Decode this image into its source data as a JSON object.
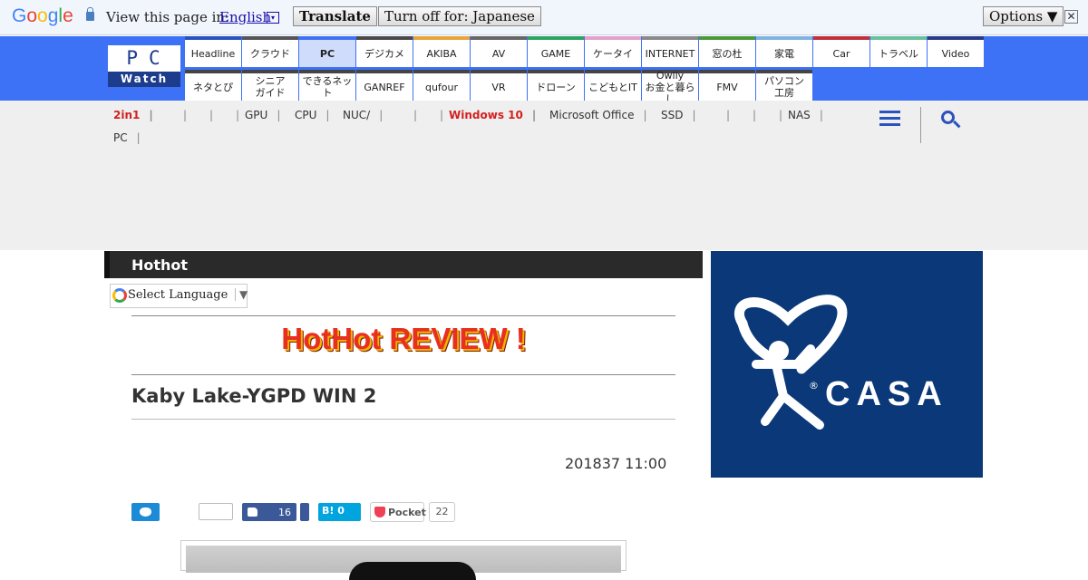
{
  "translate_bar": {
    "logo": [
      "G",
      "o",
      "o",
      "g",
      "l",
      "e"
    ],
    "view_text": "View this page in:",
    "language": "English",
    "language_caret": "▾",
    "translate_label": "Translate",
    "turnoff_label": "Turn off for: Japanese",
    "options_label": "Options ▼",
    "close_label": "✕"
  },
  "site": {
    "logo_top": "PC",
    "logo_bottom": "Watch"
  },
  "nav": {
    "row1": [
      {
        "label": "Headline",
        "color": "#2a52be"
      },
      {
        "label": "クラウド",
        "color": "#555555"
      },
      {
        "label": "PC",
        "color": "#3e72f6",
        "active": true
      },
      {
        "label": "デジカメ",
        "color": "#4a4a4a"
      },
      {
        "label": "AKIBA",
        "color": "#e8a33b"
      },
      {
        "label": "AV",
        "color": "#666666"
      },
      {
        "label": "GAME",
        "color": "#2fa35f"
      },
      {
        "label": "ケータイ",
        "color": "#e4a0c8"
      },
      {
        "label": "INTERNET",
        "color": "#8a8a8a"
      },
      {
        "label": "窓の杜",
        "color": "#4a9a3a"
      },
      {
        "label": "家電",
        "color": "#7fb4e0"
      },
      {
        "label": "Car",
        "color": "#c0303a"
      },
      {
        "label": "トラベル",
        "color": "#6ac09a"
      },
      {
        "label": "Video",
        "color": "#2a3a8a"
      }
    ],
    "row2": [
      {
        "label": "ネタとぴ",
        "color": "#444444"
      },
      {
        "label": "シニア\nガイド",
        "color": "#444444"
      },
      {
        "label": "できるネット",
        "color": "#444444"
      },
      {
        "label": "GANREF",
        "color": "#444444"
      },
      {
        "label": "qufour",
        "color": "#444444"
      },
      {
        "label": "VR",
        "color": "#444444"
      },
      {
        "label": "ドローン",
        "color": "#444444"
      },
      {
        "label": "こどもとIT",
        "color": "#444444"
      },
      {
        "label": "Owlly\nお金と暮らし",
        "color": "#444444"
      },
      {
        "label": "FMV",
        "color": "#444444"
      },
      {
        "label": "パソコン\n工房",
        "color": "#444444"
      }
    ]
  },
  "subnav": {
    "tags_line1": [
      {
        "label": "2in1",
        "highlight": true
      },
      {
        "label": "",
        "highlight": false
      },
      {
        "label": "",
        "highlight": false
      },
      {
        "label": "",
        "highlight": false
      },
      {
        "label": "GPU",
        "highlight": false
      },
      {
        "label": "CPU",
        "highlight": false
      },
      {
        "label": "NUC/",
        "highlight": false
      },
      {
        "label": "",
        "highlight": false
      },
      {
        "label": "",
        "highlight": false
      },
      {
        "label": "Windows 10",
        "highlight": true
      },
      {
        "label": "Microsoft Office",
        "highlight": false
      },
      {
        "label": "SSD",
        "highlight": false
      },
      {
        "label": "",
        "highlight": false
      },
      {
        "label": "",
        "highlight": false
      },
      {
        "label": "",
        "highlight": false
      },
      {
        "label": "NAS",
        "highlight": false
      }
    ],
    "tags_line2": [
      {
        "label": "PC",
        "highlight": false
      }
    ],
    "separator": "|"
  },
  "article": {
    "section": "Hothot",
    "lang_select": "Select Language",
    "lang_arrow": "▼",
    "banner": "HotHot  REVIEW !",
    "title": "Kaby Lake-YGPD WIN 2",
    "date": "201837 11:00",
    "share": {
      "like_count": "16",
      "hatena": "B! 0",
      "pocket": "Pocket",
      "pocket_count": "22"
    }
  },
  "ad": {
    "brand": "CASA",
    "reg": "®",
    "bg_color": "#0a3878"
  }
}
